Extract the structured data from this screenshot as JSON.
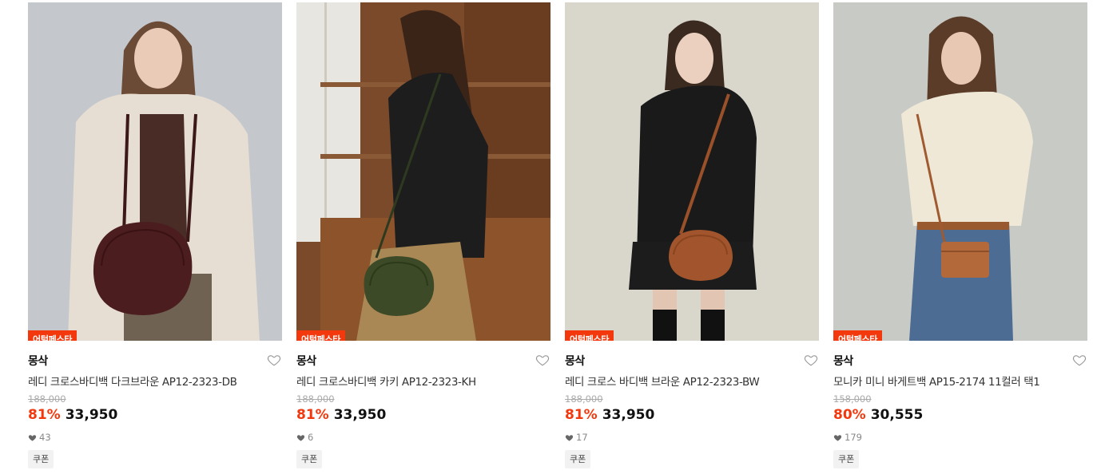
{
  "colors": {
    "badge": "#f3380d",
    "discount": "#f3380d"
  },
  "products": [
    {
      "badge": "어텀페스타",
      "brand": "몽삭",
      "title": "레디 크로스바디백 다크브라운 AP12-2323-DB",
      "original_price": "188,000",
      "discount": "81%",
      "price": "33,950",
      "likes": "43",
      "coupon": "쿠폰"
    },
    {
      "badge": "어텀페스타",
      "brand": "몽삭",
      "title": "레디 크로스바디백 카키 AP12-2323-KH",
      "original_price": "188,000",
      "discount": "81%",
      "price": "33,950",
      "likes": "6",
      "coupon": "쿠폰"
    },
    {
      "badge": "어텀페스타",
      "brand": "몽삭",
      "title": "레디 크로스 바디백 브라운 AP12-2323-BW",
      "original_price": "188,000",
      "discount": "81%",
      "price": "33,950",
      "likes": "17",
      "coupon": "쿠폰"
    },
    {
      "badge": "어텀페스타",
      "brand": "몽삭",
      "title": "모니카 미니 바게트백 AP15-2174 11컬러 택1",
      "original_price": "158,000",
      "discount": "80%",
      "price": "30,555",
      "likes": "179",
      "coupon": "쿠폰"
    }
  ],
  "icons": {
    "wishlist": "heart-outline-icon",
    "likes": "heart-filled-icon"
  }
}
